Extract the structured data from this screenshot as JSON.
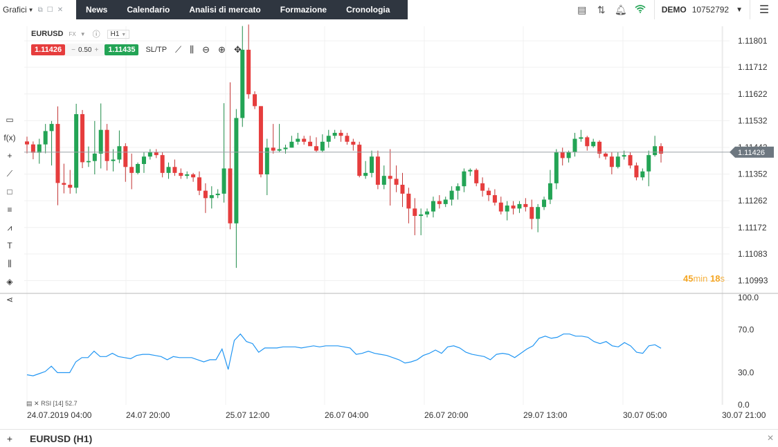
{
  "header": {
    "menu_label": "Grafici",
    "nav": [
      "News",
      "Calendario",
      "Analisi di mercato",
      "Formazione",
      "Cronologia"
    ],
    "account_mode": "DEMO",
    "account_number": "10752792",
    "icons": [
      "layout-icon",
      "price-alert-icon",
      "bell-icon",
      "wifi-icon"
    ]
  },
  "symbol": {
    "name": "EURUSD",
    "type": "FX",
    "timeframe": "H1",
    "sell_price": "1.11426",
    "volume": "0.50",
    "buy_price": "1.11435",
    "sltp_label": "SL/TP"
  },
  "countdown": {
    "minutes": "45",
    "min_unit": "min",
    "seconds": "18",
    "sec_unit": "s"
  },
  "rsi": {
    "label": "RSI [14] 52.7"
  },
  "bottom_tab": "EURUSD (H1)",
  "colors": {
    "up": "#23a455",
    "down": "#e63d3d",
    "rsi_line": "#2196f3",
    "nav_bg": "#2f3640",
    "countdown": "#f5a623"
  },
  "chart_data": {
    "type": "candlestick",
    "ylim": [
      1.1095,
      1.1185
    ],
    "y_ticks": [
      "1.11801",
      "1.11712",
      "1.11622",
      "1.11532",
      "1.11442",
      "1.11352",
      "1.11262",
      "1.11172",
      "1.11083",
      "1.10993"
    ],
    "current_price": "1.11426",
    "x_ticks": [
      "24.07.2019 04:00",
      "24.07 20:00",
      "25.07 12:00",
      "26.07 04:00",
      "26.07 20:00",
      "29.07 13:00",
      "30.07 05:00",
      "30.07 21:00"
    ],
    "candles": [
      [
        1.11462,
        1.11478,
        1.11422,
        1.11452
      ],
      [
        1.11452,
        1.11462,
        1.11402,
        1.11424
      ],
      [
        1.11424,
        1.11471,
        1.11387,
        1.11452
      ],
      [
        1.11452,
        1.11521,
        1.11422,
        1.11497
      ],
      [
        1.11497,
        1.11531,
        1.11381,
        1.11521
      ],
      [
        1.11521,
        1.1158,
        1.11247,
        1.11322
      ],
      [
        1.11322,
        1.11387,
        1.11287,
        1.11316
      ],
      [
        1.11316,
        1.11366,
        1.11286,
        1.11306
      ],
      [
        1.11306,
        1.11589,
        1.11287,
        1.11554
      ],
      [
        1.11554,
        1.11568,
        1.11372,
        1.11392
      ],
      [
        1.11392,
        1.11445,
        1.11376,
        1.11396
      ],
      [
        1.11396,
        1.11531,
        1.11351,
        1.11421
      ],
      [
        1.11421,
        1.1159,
        1.11371,
        1.11501
      ],
      [
        1.11501,
        1.11521,
        1.11364,
        1.11396
      ],
      [
        1.11396,
        1.11436,
        1.11361,
        1.11401
      ],
      [
        1.11401,
        1.11499,
        1.11389,
        1.11446
      ],
      [
        1.11446,
        1.11456,
        1.11326,
        1.11376
      ],
      [
        1.11376,
        1.11421,
        1.11301,
        1.11356
      ],
      [
        1.11356,
        1.11391,
        1.11351,
        1.11386
      ],
      [
        1.11386,
        1.11426,
        1.11356,
        1.11411
      ],
      [
        1.11411,
        1.11436,
        1.11401,
        1.11426
      ],
      [
        1.11426,
        1.11436,
        1.11406,
        1.11416
      ],
      [
        1.11416,
        1.11426,
        1.11341,
        1.11356
      ],
      [
        1.11356,
        1.11391,
        1.11336,
        1.11376
      ],
      [
        1.11376,
        1.11401,
        1.11346,
        1.11356
      ],
      [
        1.11356,
        1.11371,
        1.11336,
        1.11346
      ],
      [
        1.11346,
        1.11361,
        1.11336,
        1.11351
      ],
      [
        1.11351,
        1.11356,
        1.11326,
        1.11341
      ],
      [
        1.11341,
        1.11361,
        1.11281,
        1.11296
      ],
      [
        1.11296,
        1.11321,
        1.11221,
        1.11271
      ],
      [
        1.11271,
        1.11311,
        1.11236,
        1.11281
      ],
      [
        1.11281,
        1.11301,
        1.11271,
        1.11286
      ],
      [
        1.11286,
        1.11591,
        1.11256,
        1.11371
      ],
      [
        1.11371,
        1.11661,
        1.11166,
        1.11186
      ],
      [
        1.11186,
        1.11571,
        1.11036,
        1.11541
      ],
      [
        1.11541,
        1.11851,
        1.11511,
        1.11771
      ],
      [
        1.11771,
        1.11856,
        1.11606,
        1.11621
      ],
      [
        1.11621,
        1.11631,
        1.11571,
        1.11581
      ],
      [
        1.11581,
        1.11581,
        1.11341,
        1.11351
      ],
      [
        1.11351,
        1.11471,
        1.11281,
        1.11441
      ],
      [
        1.11441,
        1.11521,
        1.11421,
        1.11431
      ],
      [
        1.11431,
        1.11521,
        1.11426,
        1.11436
      ],
      [
        1.11436,
        1.11451,
        1.11421,
        1.11441
      ],
      [
        1.11441,
        1.11481,
        1.11441,
        1.11461
      ],
      [
        1.11461,
        1.11491,
        1.11451,
        1.11471
      ],
      [
        1.11471,
        1.11481,
        1.11451,
        1.11461
      ],
      [
        1.11461,
        1.11481,
        1.11451,
        1.11446
      ],
      [
        1.11446,
        1.11476,
        1.11426,
        1.11431
      ],
      [
        1.11431,
        1.11486,
        1.11426,
        1.11461
      ],
      [
        1.11461,
        1.11501,
        1.11441,
        1.11481
      ],
      [
        1.11481,
        1.11501,
        1.11471,
        1.11491
      ],
      [
        1.11491,
        1.11501,
        1.11461,
        1.11481
      ],
      [
        1.11481,
        1.11491,
        1.11451,
        1.11461
      ],
      [
        1.11461,
        1.11471,
        1.11431,
        1.11451
      ],
      [
        1.11451,
        1.11461,
        1.11341,
        1.11346
      ],
      [
        1.11346,
        1.11396,
        1.11336,
        1.11356
      ],
      [
        1.11356,
        1.11431,
        1.11341,
        1.11411
      ],
      [
        1.11411,
        1.11431,
        1.11301,
        1.11316
      ],
      [
        1.11316,
        1.11381,
        1.11301,
        1.11346
      ],
      [
        1.11346,
        1.11436,
        1.11246,
        1.11336
      ],
      [
        1.11336,
        1.11381,
        1.11291,
        1.11316
      ],
      [
        1.11316,
        1.11356,
        1.11241,
        1.11286
      ],
      [
        1.11286,
        1.11306,
        1.11186,
        1.11236
      ],
      [
        1.11236,
        1.11271,
        1.11146,
        1.11211
      ],
      [
        1.11211,
        1.11236,
        1.11146,
        1.11216
      ],
      [
        1.11216,
        1.11236,
        1.11206,
        1.11226
      ],
      [
        1.11226,
        1.11276,
        1.11206,
        1.11261
      ],
      [
        1.11261,
        1.11281,
        1.11236,
        1.11251
      ],
      [
        1.11251,
        1.11276,
        1.11241,
        1.11266
      ],
      [
        1.11266,
        1.11311,
        1.11246,
        1.11296
      ],
      [
        1.11296,
        1.11321,
        1.11266,
        1.11311
      ],
      [
        1.11311,
        1.11371,
        1.11291,
        1.11361
      ],
      [
        1.11361,
        1.11371,
        1.11346,
        1.11366
      ],
      [
        1.11366,
        1.11371,
        1.11311,
        1.11321
      ],
      [
        1.11321,
        1.11341,
        1.11276,
        1.11296
      ],
      [
        1.11296,
        1.11306,
        1.11261,
        1.11281
      ],
      [
        1.11281,
        1.11301,
        1.11246,
        1.11256
      ],
      [
        1.11256,
        1.11276,
        1.11216,
        1.11226
      ],
      [
        1.11226,
        1.11261,
        1.11196,
        1.11246
      ],
      [
        1.11246,
        1.11261,
        1.11216,
        1.11236
      ],
      [
        1.11236,
        1.11261,
        1.11221,
        1.11251
      ],
      [
        1.11251,
        1.11271,
        1.11226,
        1.11241
      ],
      [
        1.11241,
        1.11266,
        1.11166,
        1.11201
      ],
      [
        1.11201,
        1.11251,
        1.11156,
        1.11241
      ],
      [
        1.11241,
        1.11276,
        1.11231,
        1.11266
      ],
      [
        1.11266,
        1.11366,
        1.11251,
        1.11321
      ],
      [
        1.11321,
        1.11436,
        1.11301,
        1.11426
      ],
      [
        1.11426,
        1.11441,
        1.11381,
        1.11406
      ],
      [
        1.11406,
        1.11431,
        1.11391,
        1.11426
      ],
      [
        1.11426,
        1.11491,
        1.11411,
        1.11471
      ],
      [
        1.11471,
        1.11501,
        1.11461,
        1.11476
      ],
      [
        1.11476,
        1.11481,
        1.11431,
        1.11446
      ],
      [
        1.11446,
        1.11471,
        1.11441,
        1.11461
      ],
      [
        1.11461,
        1.11466,
        1.11406,
        1.11421
      ],
      [
        1.11421,
        1.11426,
        1.11401,
        1.11411
      ],
      [
        1.11411,
        1.11426,
        1.11351,
        1.11376
      ],
      [
        1.11376,
        1.11426,
        1.11371,
        1.11411
      ],
      [
        1.11411,
        1.11431,
        1.11401,
        1.11416
      ],
      [
        1.11416,
        1.11426,
        1.11371,
        1.11381
      ],
      [
        1.11381,
        1.11391,
        1.11331,
        1.11341
      ],
      [
        1.11341,
        1.11371,
        1.11331,
        1.11361
      ],
      [
        1.11361,
        1.11431,
        1.11311,
        1.11416
      ],
      [
        1.11416,
        1.11481,
        1.11411,
        1.11446
      ],
      [
        1.11446,
        1.11456,
        1.11391,
        1.11421
      ]
    ],
    "rsi": {
      "name": "RSI [14]",
      "ylim": [
        0,
        100
      ],
      "y_ticks": [
        "100.0",
        "70.0",
        "30.0",
        "0.0"
      ],
      "values": [
        28,
        27,
        29,
        31,
        36,
        30,
        30,
        30,
        40,
        44,
        44,
        50,
        45,
        45,
        48,
        45,
        44,
        43,
        46,
        47,
        47,
        46,
        45,
        42,
        45,
        44,
        44,
        44,
        42,
        40,
        42,
        42,
        52,
        33,
        60,
        66,
        59,
        57,
        49,
        53,
        53,
        53,
        54,
        54,
        54,
        53,
        54,
        55,
        54,
        55,
        55,
        55,
        54,
        53,
        47,
        48,
        50,
        48,
        47,
        46,
        44,
        42,
        39,
        40,
        42,
        46,
        48,
        51,
        48,
        54,
        55,
        53,
        49,
        47,
        46,
        45,
        42,
        47,
        48,
        47,
        44,
        48,
        52,
        55,
        62,
        64,
        62,
        63,
        66,
        66,
        64,
        64,
        63,
        59,
        57,
        59,
        55,
        54,
        58,
        55,
        49,
        48,
        55,
        56,
        52.7
      ]
    }
  }
}
